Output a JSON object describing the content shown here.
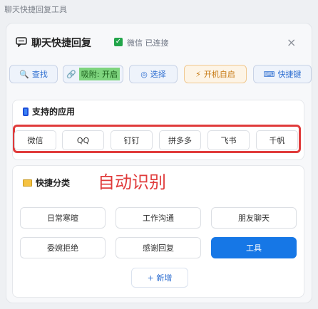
{
  "window": {
    "title": "聊天快捷回复工具"
  },
  "header": {
    "title": "聊天快捷回复",
    "status": "微信 已连接",
    "close": "×"
  },
  "toolbar": {
    "search": {
      "icon": "search-icon",
      "label": "查找"
    },
    "adsorb": {
      "icon": "link-icon",
      "label": "吸附: 开启"
    },
    "select": {
      "icon": "target-icon",
      "label": "选择"
    },
    "boot": {
      "icon": "lightning-icon",
      "label": "开机自启"
    },
    "hotkey": {
      "icon": "keyboard-icon",
      "label": "快捷键"
    }
  },
  "apps": {
    "title": "支持的应用",
    "items": [
      "微信",
      "QQ",
      "钉钉",
      "拼多多",
      "飞书",
      "千帆"
    ]
  },
  "categories": {
    "title": "快捷分类",
    "annotation": "自动识别",
    "items": [
      "日常寒暄",
      "工作沟通",
      "朋友聊天",
      "委婉拒绝",
      "感谢回复",
      "工具"
    ],
    "active": "工具",
    "add_label": "+ 新增"
  },
  "colors": {
    "accent": "#1677e6",
    "highlight": "#e03b3b",
    "connected": "#22a54a"
  }
}
